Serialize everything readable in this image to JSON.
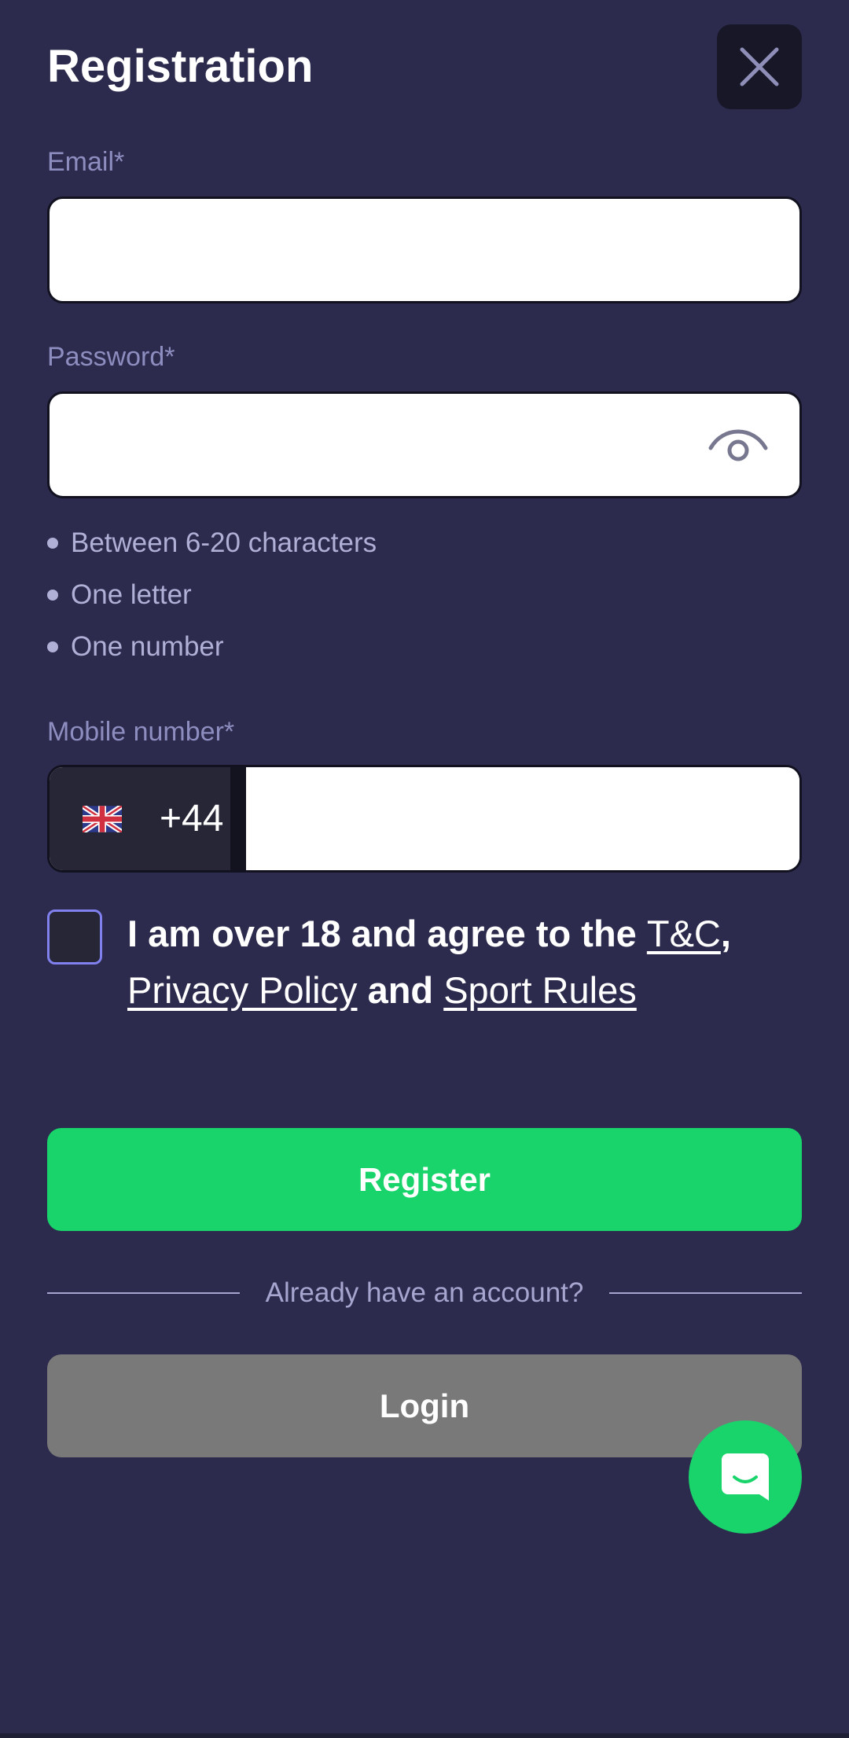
{
  "header": {
    "title": "Registration"
  },
  "form": {
    "email": {
      "label": "Email*",
      "value": "",
      "placeholder": ""
    },
    "password": {
      "label": "Password*",
      "value": "",
      "placeholder": "",
      "rules": [
        "Between 6-20 characters",
        "One letter",
        "One number"
      ]
    },
    "mobile": {
      "label": "Mobile number*",
      "country_code": "+44",
      "value": "",
      "placeholder": ""
    },
    "agreement": {
      "text_prefix": "I am over 18 and agree to the ",
      "terms_link": "T&C",
      "comma": ",",
      "privacy_link": "Privacy Policy",
      "and_text": " and ",
      "sport_rules_link": "Sport Rules",
      "checked": false
    },
    "register_label": "Register"
  },
  "login_section": {
    "divider_text": "Already have an account?",
    "login_label": "Login"
  },
  "colors": {
    "background": "#2c2b4d",
    "accent_green": "#18d46b",
    "login_gray": "#797979",
    "checkbox_border": "#8080ee"
  },
  "icons": {
    "close": "close-icon",
    "password_toggle": "eye-icon",
    "flag": "uk-flag-icon",
    "chat": "chat-icon"
  }
}
